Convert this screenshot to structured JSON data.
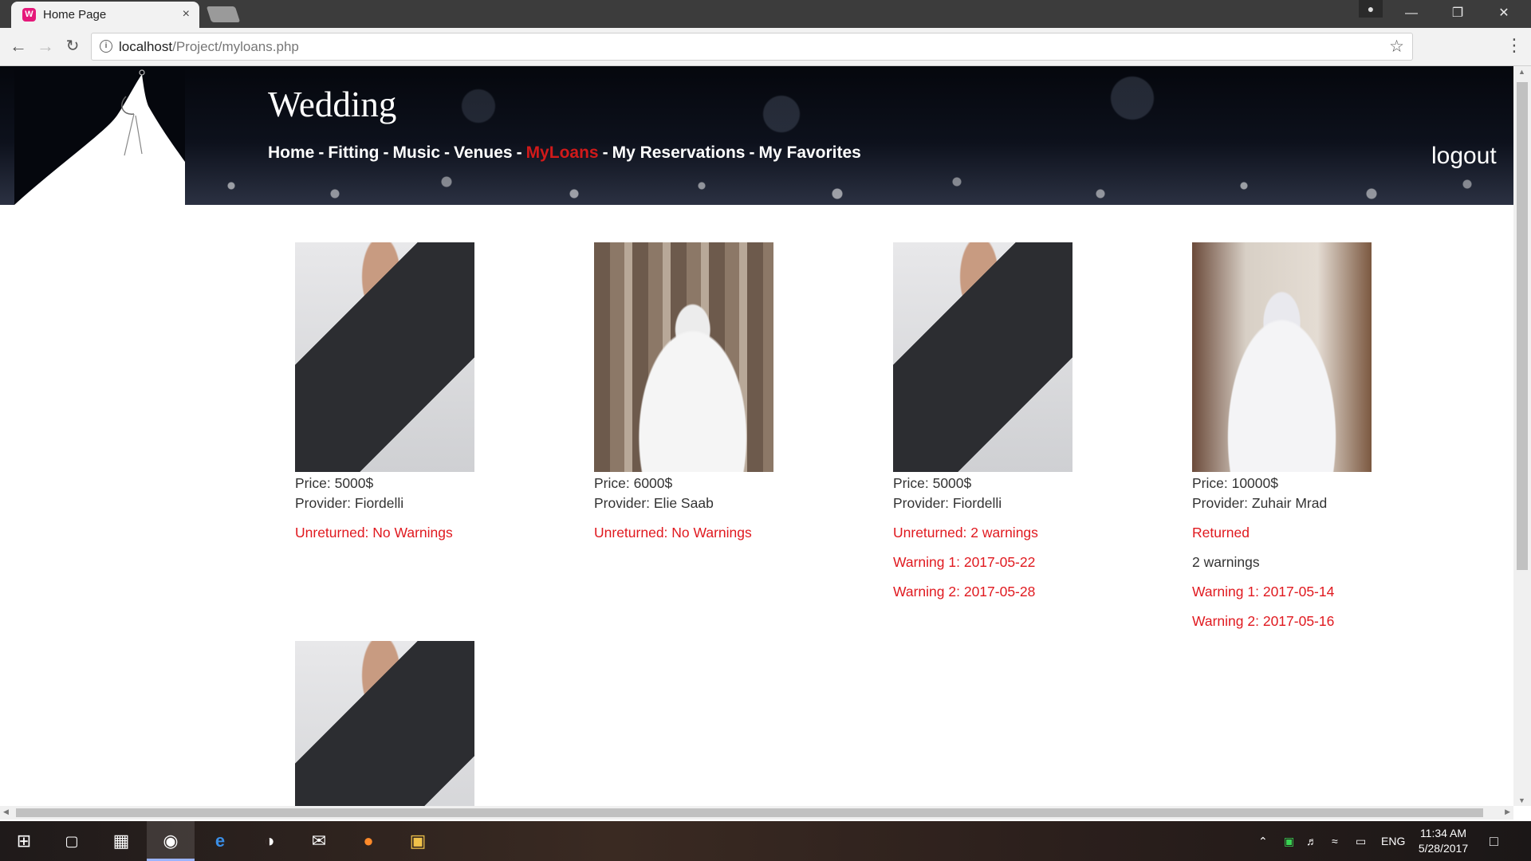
{
  "browser": {
    "tab_title": "Home Page",
    "tab_close": "×",
    "url_host": "localhost",
    "url_path": "/Project/myloans.php",
    "win_minimize": "—",
    "win_restore": "❐",
    "win_close": "✕"
  },
  "site": {
    "title": "Wedding",
    "nav": [
      {
        "label": "Home"
      },
      {
        "label": "Fitting"
      },
      {
        "label": "Music"
      },
      {
        "label": "Venues"
      },
      {
        "label": "MyLoans"
      },
      {
        "label": "My Reservations"
      },
      {
        "label": "My Favorites"
      }
    ],
    "nav_sep": "-",
    "active_nav": "MyLoans",
    "logout": "logout"
  },
  "loans": [
    {
      "image": "suit",
      "price": "Price: 5000$",
      "provider": "Provider: Fiordelli",
      "status": "Unreturned: No Warnings"
    },
    {
      "image": "dress",
      "price": "Price: 6000$",
      "provider": "Provider: Elie Saab",
      "status": "Unreturned: No Warnings"
    },
    {
      "image": "suit",
      "price": "Price: 5000$",
      "provider": "Provider: Fiordelli",
      "status": "Unreturned: 2 warnings",
      "warning1": "Warning 1: 2017-05-22",
      "warning2": "Warning 2: 2017-05-28"
    },
    {
      "image": "dress",
      "price": "Price: 10000$",
      "provider": "Provider: Zuhair Mrad",
      "status": "Returned",
      "warnings_count": "2 warnings",
      "warning1": "Warning 1: 2017-05-14",
      "warning2": "Warning 2: 2017-05-16"
    },
    {
      "image": "suit"
    }
  ],
  "taskbar": {
    "time": "11:34 AM",
    "date": "5/28/2017",
    "lang": "ENG"
  },
  "colors": {
    "accent_red": "#e0191f",
    "nav_active": "#d11a1a"
  }
}
